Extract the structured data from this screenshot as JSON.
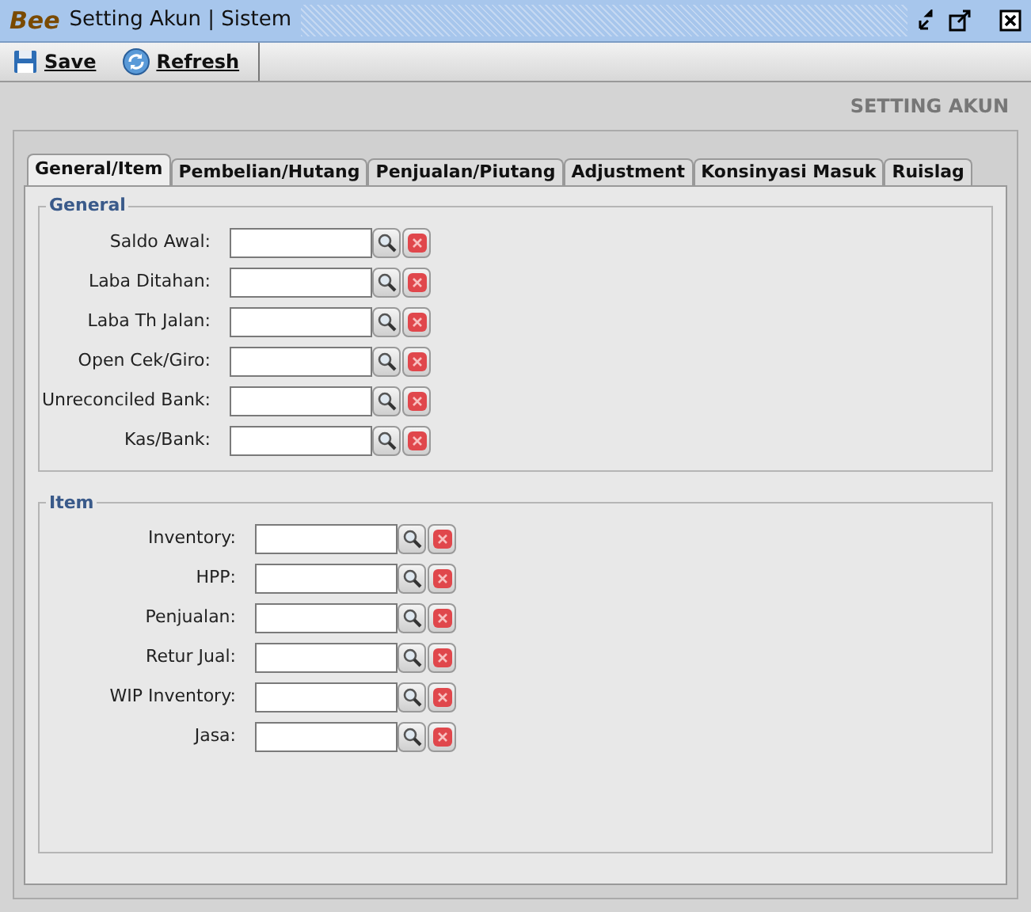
{
  "window": {
    "logo": "Bee",
    "title": "Setting Akun | Sistem"
  },
  "toolbar": [
    {
      "label": "Save",
      "kind": "save"
    },
    {
      "label": "Refresh",
      "kind": "refresh"
    }
  ],
  "page_title": "SETTING AKUN",
  "tabs": [
    {
      "label": "General/Item",
      "selected": true
    },
    {
      "label": "Pembelian/Hutang",
      "selected": false
    },
    {
      "label": "Penjualan/Piutang",
      "selected": false
    },
    {
      "label": "Adjustment",
      "selected": false
    },
    {
      "label": "Konsinyasi Masuk",
      "selected": false
    },
    {
      "label": "Ruislag",
      "selected": false
    }
  ],
  "groups": [
    {
      "title": "General",
      "fields": [
        {
          "label": "Saldo Awal:"
        },
        {
          "label": "Laba Ditahan:"
        },
        {
          "label": "Laba Th Jalan:"
        },
        {
          "label": "Open Cek/Giro:"
        },
        {
          "label": "Unreconciled Bank:"
        },
        {
          "label": "Kas/Bank:"
        }
      ]
    },
    {
      "title": "Item",
      "fields": [
        {
          "label": "Inventory:"
        },
        {
          "label": "HPP:"
        },
        {
          "label": "Penjualan:"
        },
        {
          "label": "Retur Jual:"
        },
        {
          "label": "WIP Inventory:"
        },
        {
          "label": "Jasa:"
        }
      ]
    }
  ]
}
